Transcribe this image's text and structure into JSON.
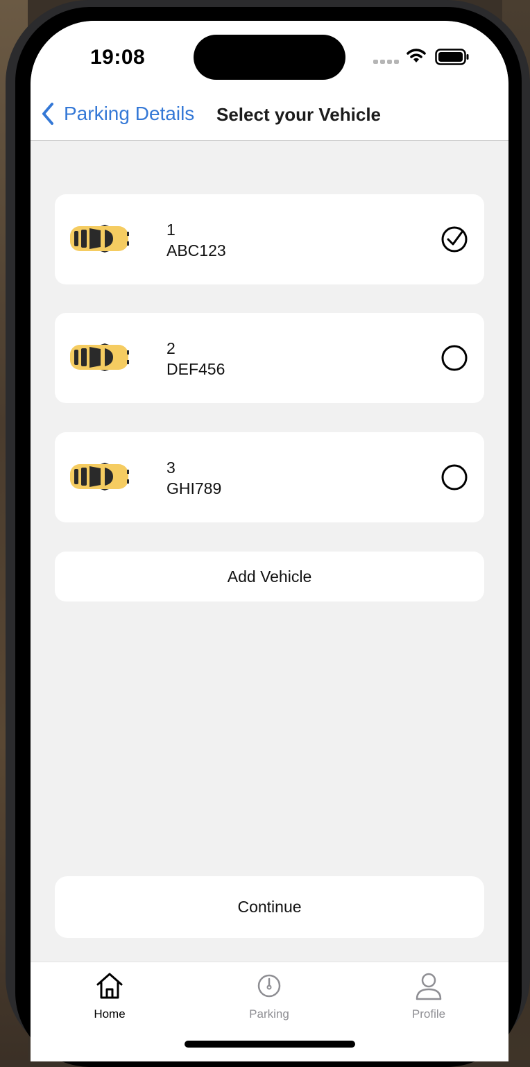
{
  "status_bar": {
    "time": "19:08"
  },
  "nav": {
    "back_label": "Parking Details",
    "title": "Select your Vehicle"
  },
  "vehicles": [
    {
      "number": "1",
      "plate": "ABC123",
      "selected": true
    },
    {
      "number": "2",
      "plate": "DEF456",
      "selected": false
    },
    {
      "number": "3",
      "plate": "GHI789",
      "selected": false
    }
  ],
  "add_vehicle_label": "Add Vehicle",
  "continue_label": "Continue",
  "tabs": [
    {
      "label": "Home",
      "icon": "home-icon",
      "active": true
    },
    {
      "label": "Parking",
      "icon": "speedometer-icon",
      "active": false
    },
    {
      "label": "Profile",
      "icon": "person-icon",
      "active": false
    }
  ],
  "colors": {
    "accent": "#3478d6",
    "car_body": "#f5cc61",
    "inactive_tab": "#8e8e93"
  }
}
